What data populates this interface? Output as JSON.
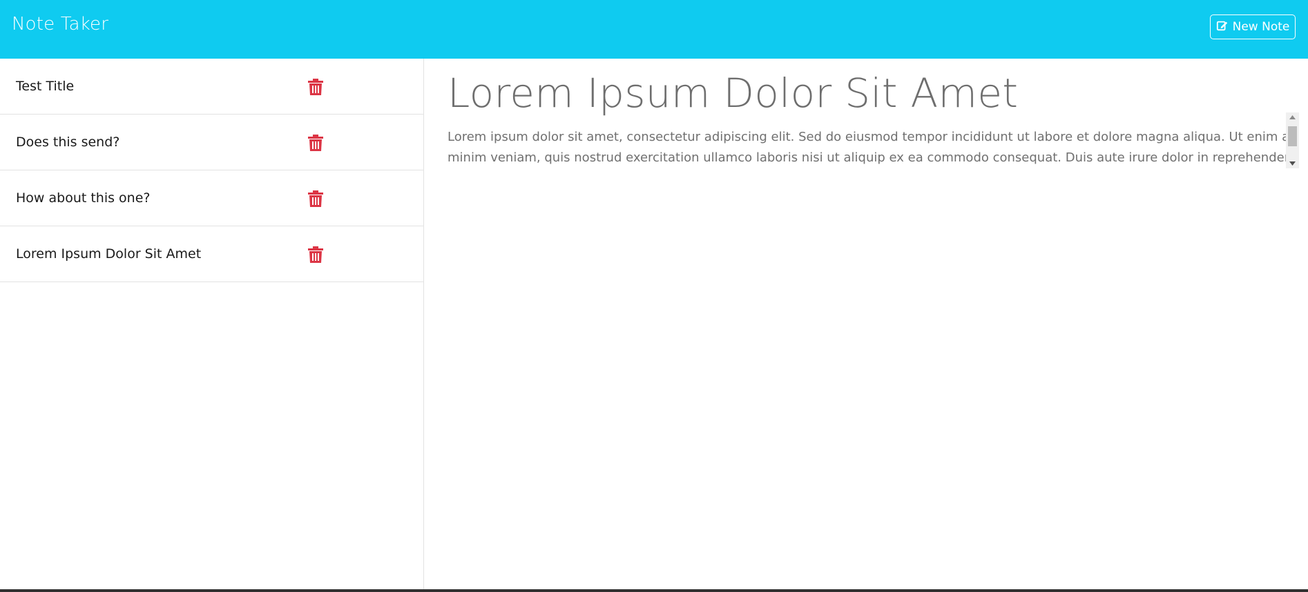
{
  "app": {
    "title": "Note Taker",
    "new_note_label": "New Note",
    "brand_color": "#0fcbf0",
    "delete_color": "#dc3545"
  },
  "notes": [
    {
      "title": "Test Title"
    },
    {
      "title": "Does this send?"
    },
    {
      "title": "How about this one?"
    },
    {
      "title": "Lorem Ipsum Dolor Sit Amet"
    }
  ],
  "active_note": {
    "title": "Lorem Ipsum Dolor Sit Amet",
    "body": "Lorem ipsum dolor sit amet, consectetur adipiscing elit. Sed do eiusmod tempor incididunt ut labore et dolore magna aliqua. Ut enim ad minim veniam, quis nostrud exercitation ullamco laboris nisi ut aliquip ex ea commodo consequat. Duis aute irure dolor in reprehenderit in"
  },
  "icons": {
    "new_note": "pencil-square-icon",
    "delete": "trash-icon"
  }
}
